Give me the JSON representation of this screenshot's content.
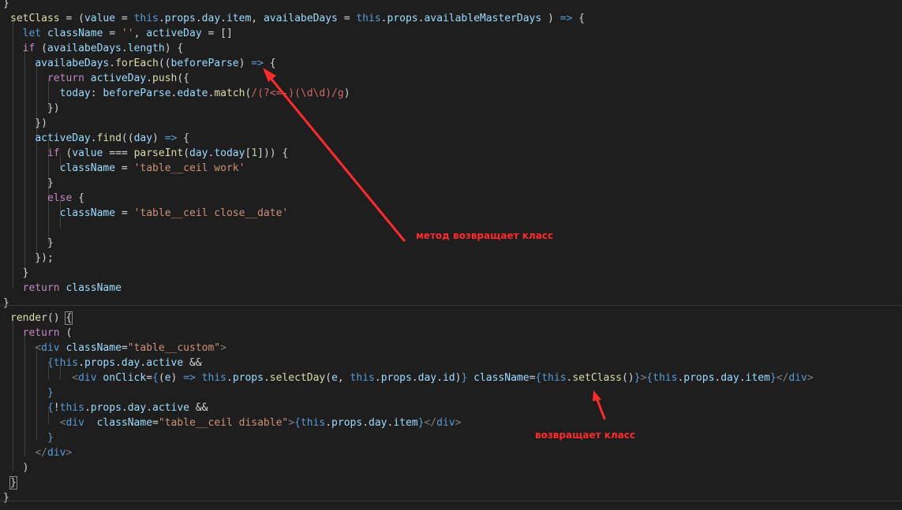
{
  "code_lines": [
    [
      [
        "p",
        "}"
      ]
    ],
    [
      [
        "f",
        "setClass"
      ],
      [
        "p",
        " = ("
      ],
      [
        "v",
        "value"
      ],
      [
        "p",
        " = "
      ],
      [
        "kb",
        "this"
      ],
      [
        "p",
        "."
      ],
      [
        "v",
        "props"
      ],
      [
        "p",
        "."
      ],
      [
        "v",
        "day"
      ],
      [
        "p",
        "."
      ],
      [
        "v",
        "item"
      ],
      [
        "p",
        ", "
      ],
      [
        "v",
        "availabeDays"
      ],
      [
        "p",
        " = "
      ],
      [
        "kb",
        "this"
      ],
      [
        "p",
        "."
      ],
      [
        "v",
        "props"
      ],
      [
        "p",
        "."
      ],
      [
        "v",
        "availableMasterDays"
      ],
      [
        "p",
        " ) "
      ],
      [
        "kb",
        "=>"
      ],
      [
        "p",
        " {"
      ]
    ],
    [
      [
        "p",
        "  "
      ],
      [
        "kb",
        "let"
      ],
      [
        "p",
        " "
      ],
      [
        "v",
        "className"
      ],
      [
        "p",
        " = "
      ],
      [
        "s",
        "''"
      ],
      [
        "p",
        ", "
      ],
      [
        "v",
        "activeDay"
      ],
      [
        "p",
        " = []"
      ]
    ],
    [
      [
        "p",
        "  "
      ],
      [
        "k",
        "if"
      ],
      [
        "p",
        " ("
      ],
      [
        "v",
        "availabeDays"
      ],
      [
        "p",
        "."
      ],
      [
        "v",
        "length"
      ],
      [
        "p",
        ") {"
      ]
    ],
    [
      [
        "p",
        "    "
      ],
      [
        "v",
        "availabeDays"
      ],
      [
        "p",
        "."
      ],
      [
        "f",
        "forEach"
      ],
      [
        "p",
        "(("
      ],
      [
        "v",
        "beforeParse"
      ],
      [
        "p",
        ") "
      ],
      [
        "kb",
        "=>"
      ],
      [
        "p",
        " {"
      ]
    ],
    [
      [
        "p",
        "      "
      ],
      [
        "k",
        "return"
      ],
      [
        "p",
        " "
      ],
      [
        "v",
        "activeDay"
      ],
      [
        "p",
        "."
      ],
      [
        "f",
        "push"
      ],
      [
        "p",
        "({"
      ]
    ],
    [
      [
        "p",
        "        "
      ],
      [
        "v",
        "today"
      ],
      [
        "p",
        ": "
      ],
      [
        "v",
        "beforeParse"
      ],
      [
        "p",
        "."
      ],
      [
        "v",
        "edate"
      ],
      [
        "p",
        "."
      ],
      [
        "f",
        "match"
      ],
      [
        "p",
        "("
      ],
      [
        "r",
        "/(?<=-)(\\d\\d)/g"
      ],
      [
        "p",
        ")"
      ]
    ],
    [
      [
        "p",
        "      })"
      ]
    ],
    [
      [
        "p",
        "    })"
      ]
    ],
    [
      [
        "p",
        "    "
      ],
      [
        "v",
        "activeDay"
      ],
      [
        "p",
        "."
      ],
      [
        "f",
        "find"
      ],
      [
        "p",
        "(("
      ],
      [
        "v",
        "day"
      ],
      [
        "p",
        ") "
      ],
      [
        "kb",
        "=>"
      ],
      [
        "p",
        " {"
      ]
    ],
    [
      [
        "p",
        "      "
      ],
      [
        "k",
        "if"
      ],
      [
        "p",
        " ("
      ],
      [
        "v",
        "value"
      ],
      [
        "p",
        " === "
      ],
      [
        "f",
        "parseInt"
      ],
      [
        "p",
        "("
      ],
      [
        "v",
        "day"
      ],
      [
        "p",
        "."
      ],
      [
        "v",
        "today"
      ],
      [
        "p",
        "["
      ],
      [
        "n",
        "1"
      ],
      [
        "p",
        "])) {"
      ]
    ],
    [
      [
        "p",
        "        "
      ],
      [
        "v",
        "className"
      ],
      [
        "p",
        " = "
      ],
      [
        "s",
        "'table__ceil work'"
      ]
    ],
    [
      [
        "p",
        "      }"
      ]
    ],
    [
      [
        "p",
        "      "
      ],
      [
        "k",
        "else"
      ],
      [
        "p",
        " {"
      ]
    ],
    [
      [
        "p",
        "        "
      ],
      [
        "v",
        "className"
      ],
      [
        "p",
        " = "
      ],
      [
        "s",
        "'table__ceil close__date'"
      ]
    ],
    [
      [
        "p",
        ""
      ]
    ],
    [
      [
        "p",
        "      }"
      ]
    ],
    [
      [
        "p",
        "    });"
      ]
    ],
    [
      [
        "p",
        "  }"
      ]
    ],
    [
      [
        "p",
        "  "
      ],
      [
        "k",
        "return"
      ],
      [
        "p",
        " "
      ],
      [
        "v",
        "className"
      ]
    ],
    [
      [
        "p",
        "}"
      ]
    ],
    [
      [
        "f",
        "render"
      ],
      [
        "p",
        "() "
      ],
      [
        "bh",
        "{"
      ]
    ],
    [
      [
        "p",
        "  "
      ],
      [
        "k",
        "return"
      ],
      [
        "p",
        " ("
      ]
    ],
    [
      [
        "p",
        "    "
      ],
      [
        "t",
        "<"
      ],
      [
        "tg",
        "div"
      ],
      [
        "p",
        " "
      ],
      [
        "at",
        "className"
      ],
      [
        "p",
        "="
      ],
      [
        "s",
        "\"table__custom\""
      ],
      [
        "t",
        ">"
      ]
    ],
    [
      [
        "p",
        "      "
      ],
      [
        "kb",
        "{"
      ],
      [
        "kb",
        "this"
      ],
      [
        "p",
        "."
      ],
      [
        "v",
        "props"
      ],
      [
        "p",
        "."
      ],
      [
        "v",
        "day"
      ],
      [
        "p",
        "."
      ],
      [
        "v",
        "active"
      ],
      [
        "p",
        " &&"
      ]
    ],
    [
      [
        "p",
        "          "
      ],
      [
        "t",
        "<"
      ],
      [
        "tg",
        "div"
      ],
      [
        "p",
        " "
      ],
      [
        "at",
        "onClick"
      ],
      [
        "p",
        "="
      ],
      [
        "kb",
        "{"
      ],
      [
        "p",
        "("
      ],
      [
        "v",
        "e"
      ],
      [
        "p",
        ") "
      ],
      [
        "kb",
        "=>"
      ],
      [
        "p",
        " "
      ],
      [
        "kb",
        "this"
      ],
      [
        "p",
        "."
      ],
      [
        "v",
        "props"
      ],
      [
        "p",
        "."
      ],
      [
        "f",
        "selectDay"
      ],
      [
        "p",
        "("
      ],
      [
        "v",
        "e"
      ],
      [
        "p",
        ", "
      ],
      [
        "kb",
        "this"
      ],
      [
        "p",
        "."
      ],
      [
        "v",
        "props"
      ],
      [
        "p",
        "."
      ],
      [
        "v",
        "day"
      ],
      [
        "p",
        "."
      ],
      [
        "v",
        "id"
      ],
      [
        "p",
        ")"
      ],
      [
        "kb",
        "}"
      ],
      [
        "p",
        " "
      ],
      [
        "at",
        "className"
      ],
      [
        "p",
        "="
      ],
      [
        "kb",
        "{"
      ],
      [
        "kb",
        "this"
      ],
      [
        "p",
        "."
      ],
      [
        "f",
        "setClass"
      ],
      [
        "p",
        "()"
      ],
      [
        "kb",
        "}"
      ],
      [
        "t",
        ">"
      ],
      [
        "kb",
        "{"
      ],
      [
        "kb",
        "this"
      ],
      [
        "p",
        "."
      ],
      [
        "v",
        "props"
      ],
      [
        "p",
        "."
      ],
      [
        "v",
        "day"
      ],
      [
        "p",
        "."
      ],
      [
        "v",
        "item"
      ],
      [
        "kb",
        "}"
      ],
      [
        "t",
        "</"
      ],
      [
        "tg",
        "div"
      ],
      [
        "t",
        ">"
      ]
    ],
    [
      [
        "p",
        "      "
      ],
      [
        "kb",
        "}"
      ]
    ],
    [
      [
        "p",
        "      "
      ],
      [
        "kb",
        "{"
      ],
      [
        "p",
        "!"
      ],
      [
        "kb",
        "this"
      ],
      [
        "p",
        "."
      ],
      [
        "v",
        "props"
      ],
      [
        "p",
        "."
      ],
      [
        "v",
        "day"
      ],
      [
        "p",
        "."
      ],
      [
        "v",
        "active"
      ],
      [
        "p",
        " &&"
      ]
    ],
    [
      [
        "p",
        "        "
      ],
      [
        "t",
        "<"
      ],
      [
        "tg",
        "div"
      ],
      [
        "p",
        "  "
      ],
      [
        "at",
        "className"
      ],
      [
        "p",
        "="
      ],
      [
        "s",
        "\"table__ceil disable\""
      ],
      [
        "t",
        ">"
      ],
      [
        "kb",
        "{"
      ],
      [
        "kb",
        "this"
      ],
      [
        "p",
        "."
      ],
      [
        "v",
        "props"
      ],
      [
        "p",
        "."
      ],
      [
        "v",
        "day"
      ],
      [
        "p",
        "."
      ],
      [
        "v",
        "item"
      ],
      [
        "kb",
        "}"
      ],
      [
        "t",
        "</"
      ],
      [
        "tg",
        "div"
      ],
      [
        "t",
        ">"
      ]
    ],
    [
      [
        "p",
        "      "
      ],
      [
        "kb",
        "}"
      ]
    ],
    [
      [
        "p",
        "    "
      ],
      [
        "t",
        "</"
      ],
      [
        "tg",
        "div"
      ],
      [
        "t",
        ">"
      ]
    ],
    [
      [
        "p",
        "  )"
      ]
    ],
    [
      [
        "bh",
        "}"
      ]
    ],
    [
      [
        "p",
        "}"
      ]
    ]
  ],
  "annotations": {
    "method_label": "метод возвращает класс",
    "returns_label": "возвращает класс"
  },
  "colors": {
    "background": "#1e1e1e",
    "annotation": "#ff2a2a"
  }
}
